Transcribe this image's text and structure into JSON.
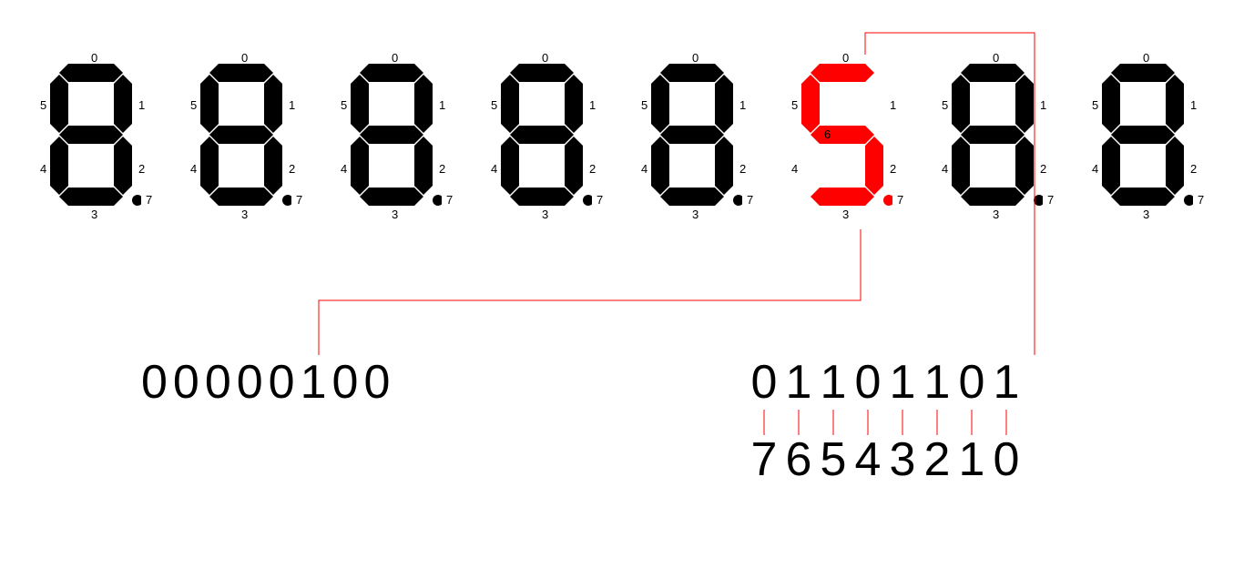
{
  "segment_labels": [
    "0",
    "1",
    "2",
    "3",
    "4",
    "5",
    "6",
    "7"
  ],
  "digits": [
    {
      "segments": [
        1,
        1,
        1,
        1,
        1,
        1,
        1
      ],
      "dp": 1,
      "highlight": false
    },
    {
      "segments": [
        1,
        1,
        1,
        1,
        1,
        1,
        1
      ],
      "dp": 1,
      "highlight": false
    },
    {
      "segments": [
        1,
        1,
        1,
        1,
        1,
        1,
        1
      ],
      "dp": 1,
      "highlight": false
    },
    {
      "segments": [
        1,
        1,
        1,
        1,
        1,
        1,
        1
      ],
      "dp": 1,
      "highlight": false
    },
    {
      "segments": [
        1,
        1,
        1,
        1,
        1,
        1,
        1
      ],
      "dp": 1,
      "highlight": false
    },
    {
      "segments": [
        1,
        0,
        1,
        1,
        0,
        1,
        1
      ],
      "dp": 1,
      "highlight": true
    },
    {
      "segments": [
        1,
        1,
        1,
        1,
        1,
        1,
        1
      ],
      "dp": 1,
      "highlight": false
    },
    {
      "segments": [
        1,
        1,
        1,
        1,
        1,
        1,
        1
      ],
      "dp": 1,
      "highlight": false
    }
  ],
  "binary_left": "00000100",
  "binary_right": "01101101",
  "index_row": "76543210"
}
